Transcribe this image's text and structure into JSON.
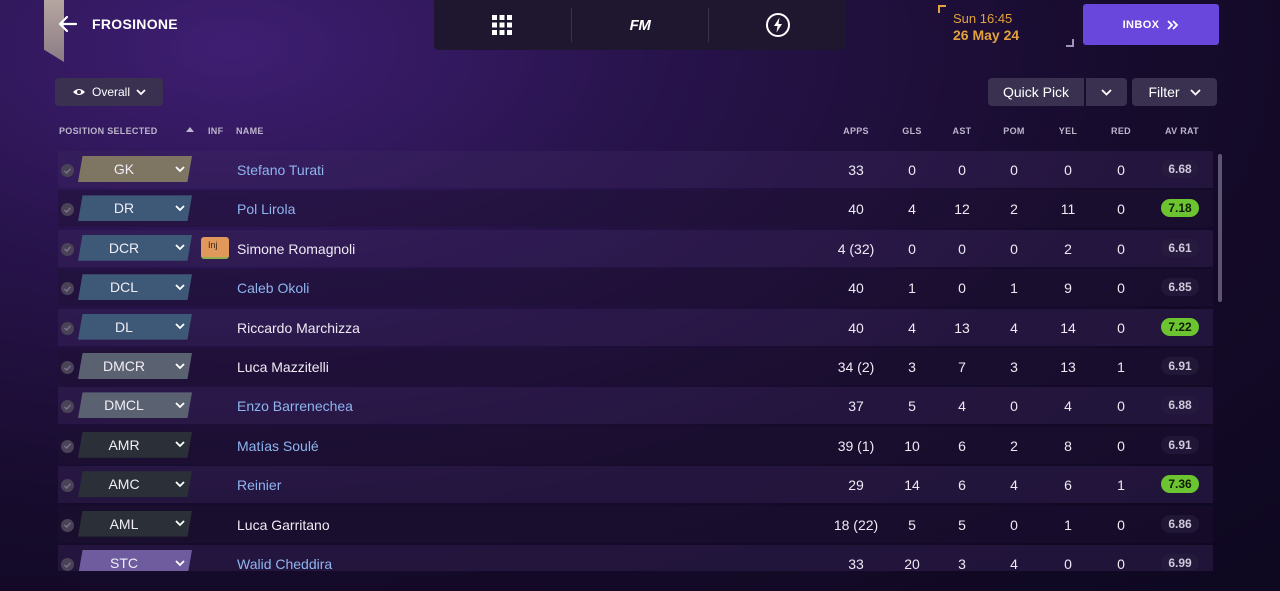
{
  "header": {
    "club_name": "FROSINONE",
    "time": "Sun 16:45",
    "date": "26 May 24",
    "inbox_label": "INBOX",
    "fm_logo": "FM"
  },
  "controls": {
    "view_label": "Overall",
    "quick_pick_label": "Quick Pick",
    "filter_label": "Filter"
  },
  "columns": {
    "position": "POSITION SELECTED",
    "inf": "INF",
    "name": "NAME",
    "apps": "APPS",
    "gls": "GLS",
    "ast": "AST",
    "pom": "POM",
    "yel": "YEL",
    "red": "RED",
    "avrat": "AV RAT"
  },
  "colors": {
    "accent": "#6a47dc",
    "date": "#e3a23b",
    "link": "#8eb5ef",
    "rating_good": "#6cc530",
    "injury": "#e0995a"
  },
  "players": [
    {
      "position": "GK",
      "pos_color": "#7e7563",
      "inj": "",
      "name": "Stefano Turati",
      "link": true,
      "apps": "33",
      "gls": "0",
      "ast": "0",
      "pom": "0",
      "yel": "0",
      "red": "0",
      "avrat": "6.68",
      "good": false
    },
    {
      "position": "DR",
      "pos_color": "#3e5878",
      "inj": "",
      "name": "Pol Lirola",
      "link": true,
      "apps": "40",
      "gls": "4",
      "ast": "12",
      "pom": "2",
      "yel": "11",
      "red": "0",
      "avrat": "7.18",
      "good": true
    },
    {
      "position": "DCR",
      "pos_color": "#3e5878",
      "inj": "Inj",
      "name": "Simone Romagnoli",
      "link": false,
      "apps": "4 (32)",
      "gls": "0",
      "ast": "0",
      "pom": "0",
      "yel": "2",
      "red": "0",
      "avrat": "6.61",
      "good": false
    },
    {
      "position": "DCL",
      "pos_color": "#3e5878",
      "inj": "",
      "name": "Caleb Okoli",
      "link": true,
      "apps": "40",
      "gls": "1",
      "ast": "0",
      "pom": "1",
      "yel": "9",
      "red": "0",
      "avrat": "6.85",
      "good": false
    },
    {
      "position": "DL",
      "pos_color": "#3e5878",
      "inj": "",
      "name": "Riccardo Marchizza",
      "link": false,
      "apps": "40",
      "gls": "4",
      "ast": "13",
      "pom": "4",
      "yel": "14",
      "red": "0",
      "avrat": "7.22",
      "good": true
    },
    {
      "position": "DMCR",
      "pos_color": "#5a6272",
      "inj": "",
      "name": "Luca Mazzitelli",
      "link": false,
      "apps": "34 (2)",
      "gls": "3",
      "ast": "7",
      "pom": "3",
      "yel": "13",
      "red": "1",
      "avrat": "6.91",
      "good": false
    },
    {
      "position": "DMCL",
      "pos_color": "#5a6272",
      "inj": "",
      "name": "Enzo Barrenechea",
      "link": true,
      "apps": "37",
      "gls": "5",
      "ast": "4",
      "pom": "0",
      "yel": "4",
      "red": "0",
      "avrat": "6.88",
      "good": false
    },
    {
      "position": "AMR",
      "pos_color": "#2b3038",
      "inj": "",
      "name": "Matías Soulé",
      "link": true,
      "apps": "39 (1)",
      "gls": "10",
      "ast": "6",
      "pom": "2",
      "yel": "8",
      "red": "0",
      "avrat": "6.91",
      "good": false
    },
    {
      "position": "AMC",
      "pos_color": "#2b3038",
      "inj": "",
      "name": "Reinier",
      "link": true,
      "apps": "29",
      "gls": "14",
      "ast": "6",
      "pom": "4",
      "yel": "6",
      "red": "1",
      "avrat": "7.36",
      "good": true
    },
    {
      "position": "AML",
      "pos_color": "#2b3038",
      "inj": "",
      "name": "Luca Garritano",
      "link": false,
      "apps": "18 (22)",
      "gls": "5",
      "ast": "5",
      "pom": "0",
      "yel": "1",
      "red": "0",
      "avrat": "6.86",
      "good": false
    },
    {
      "position": "STC",
      "pos_color": "#6e5c9e",
      "inj": "",
      "name": "Walid Cheddira",
      "link": true,
      "apps": "33",
      "gls": "20",
      "ast": "3",
      "pom": "4",
      "yel": "0",
      "red": "0",
      "avrat": "6.99",
      "good": false
    }
  ]
}
